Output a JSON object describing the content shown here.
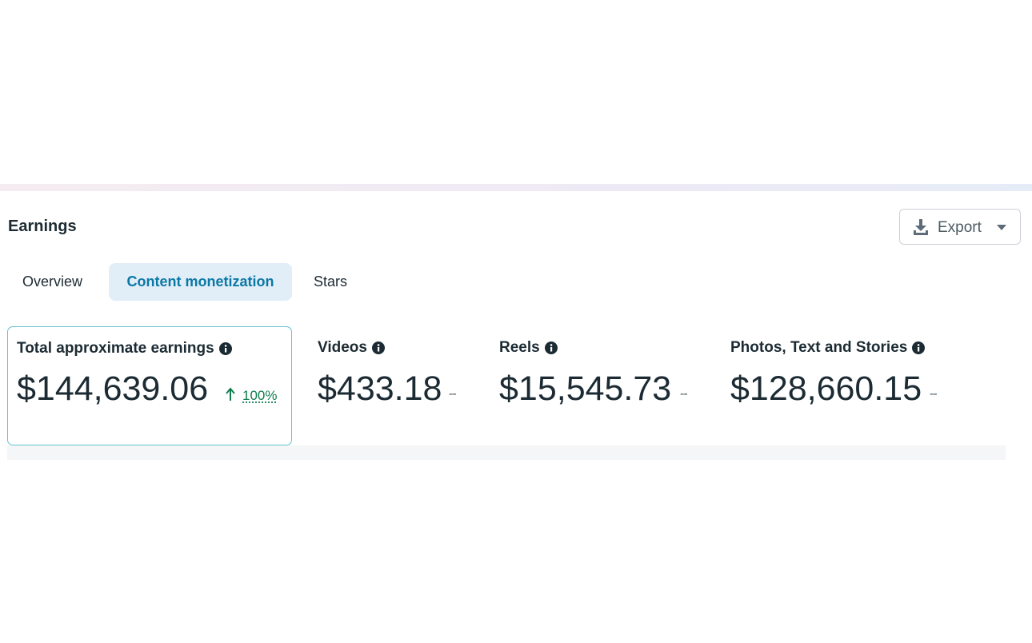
{
  "earnings": {
    "title": "Earnings",
    "export": {
      "label": "Export",
      "icon": "download-icon"
    },
    "tabs": [
      {
        "label": "Overview",
        "active": false
      },
      {
        "label": "Content monetization",
        "active": true
      },
      {
        "label": "Stars",
        "active": false
      }
    ],
    "metrics": [
      {
        "title": "Total approximate earnings",
        "value": "$144,639.06",
        "delta": "100%",
        "delta_direction": "up",
        "selected": true
      },
      {
        "title": "Videos",
        "value": "$433.18",
        "delta": "--"
      },
      {
        "title": "Reels",
        "value": "$15,545.73",
        "delta": "--"
      },
      {
        "title": "Photos, Text and Stories",
        "value": "$128,660.15",
        "delta": "--"
      }
    ]
  },
  "colors": {
    "accent": "#0a78a6",
    "active_tab_bg": "#e1edf7",
    "selected_card_border": "#66c2cf",
    "positive": "#0f7d4e",
    "text": "#1c2b33"
  }
}
